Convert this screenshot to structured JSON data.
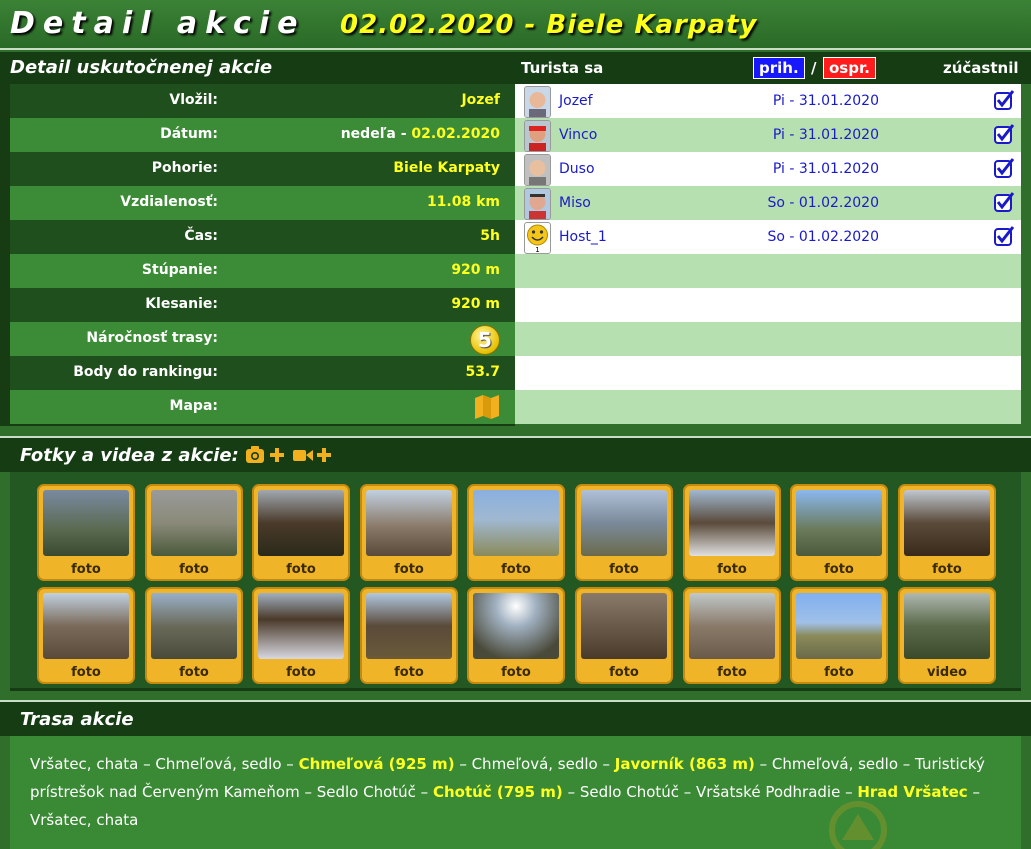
{
  "header": {
    "title": "Detail akcie",
    "event": "02.02.2020 - Biele Karpaty"
  },
  "detail": {
    "title": "Detail uskutočnenej akcie",
    "rows": [
      {
        "label": "Vložil:",
        "value": "Jozef"
      },
      {
        "label": "Dátum:",
        "day": "nedeľa",
        "sep": " - ",
        "value": "02.02.2020"
      },
      {
        "label": "Pohorie:",
        "value": "Biele Karpaty"
      },
      {
        "label": "Vzdialenosť:",
        "value": "11.08 km"
      },
      {
        "label": "Čas:",
        "value": "5h"
      },
      {
        "label": "Stúpanie:",
        "value": "920 m"
      },
      {
        "label": "Klesanie:",
        "value": "920 m"
      },
      {
        "label": "Náročnosť trasy:",
        "value": "5"
      },
      {
        "label": "Body do rankingu:",
        "value": "53.7"
      },
      {
        "label": "Mapa:",
        "icon": "map-icon"
      }
    ]
  },
  "participants": {
    "header_label": "Turista sa",
    "prih_label": "prih.",
    "slash": "/",
    "ospr_label": "ospr.",
    "zucastnil_label": "zúčastnil",
    "rows": [
      {
        "name": "Jozef",
        "date": "Pi - 31.01.2020",
        "checked": true
      },
      {
        "name": "Vinco",
        "date": "Pi - 31.01.2020",
        "checked": true
      },
      {
        "name": "Duso",
        "date": "Pi - 31.01.2020",
        "checked": true
      },
      {
        "name": "Miso",
        "date": "So - 01.02.2020",
        "checked": true
      },
      {
        "name": "Host_1",
        "date": "So - 01.02.2020",
        "checked": true,
        "avatar_badge": "1"
      }
    ]
  },
  "gallery": {
    "title": "Fotky a videa z akcie:",
    "items": [
      {
        "caption": "foto"
      },
      {
        "caption": "foto"
      },
      {
        "caption": "foto"
      },
      {
        "caption": "foto"
      },
      {
        "caption": "foto"
      },
      {
        "caption": "foto"
      },
      {
        "caption": "foto"
      },
      {
        "caption": "foto"
      },
      {
        "caption": "foto"
      },
      {
        "caption": "foto"
      },
      {
        "caption": "foto"
      },
      {
        "caption": "foto"
      },
      {
        "caption": "foto"
      },
      {
        "caption": "foto"
      },
      {
        "caption": "foto"
      },
      {
        "caption": "foto"
      },
      {
        "caption": "foto"
      },
      {
        "caption": "video"
      }
    ]
  },
  "route": {
    "title": "Trasa akcie",
    "segments": [
      {
        "text": "Vršatec, chata – Chmeľová, sedlo – ",
        "peak": false
      },
      {
        "text": "Chmeľová (925 m)",
        "peak": true
      },
      {
        "text": " – Chmeľová, sedlo – ",
        "peak": false
      },
      {
        "text": "Javorník (863 m)",
        "peak": true
      },
      {
        "text": " – Chmeľová, sedlo – Turistický prístrešok nad Červeným Kameňom – Sedlo Chotúč – ",
        "peak": false
      },
      {
        "text": "Chotúč (795 m)",
        "peak": true
      },
      {
        "text": " – Sedlo Chotúč – Vršatské Podhradie – ",
        "peak": false
      },
      {
        "text": "Hrad Vršatec",
        "peak": true
      },
      {
        "text": " – Vršatec, chata",
        "peak": false
      }
    ]
  },
  "colors": {
    "accent_yellow": "#ffff22",
    "dark_green": "#163c14",
    "row_green": "#3c8c37",
    "participant_green": "#b7e0b0",
    "link_blue": "#1a1ac8"
  }
}
